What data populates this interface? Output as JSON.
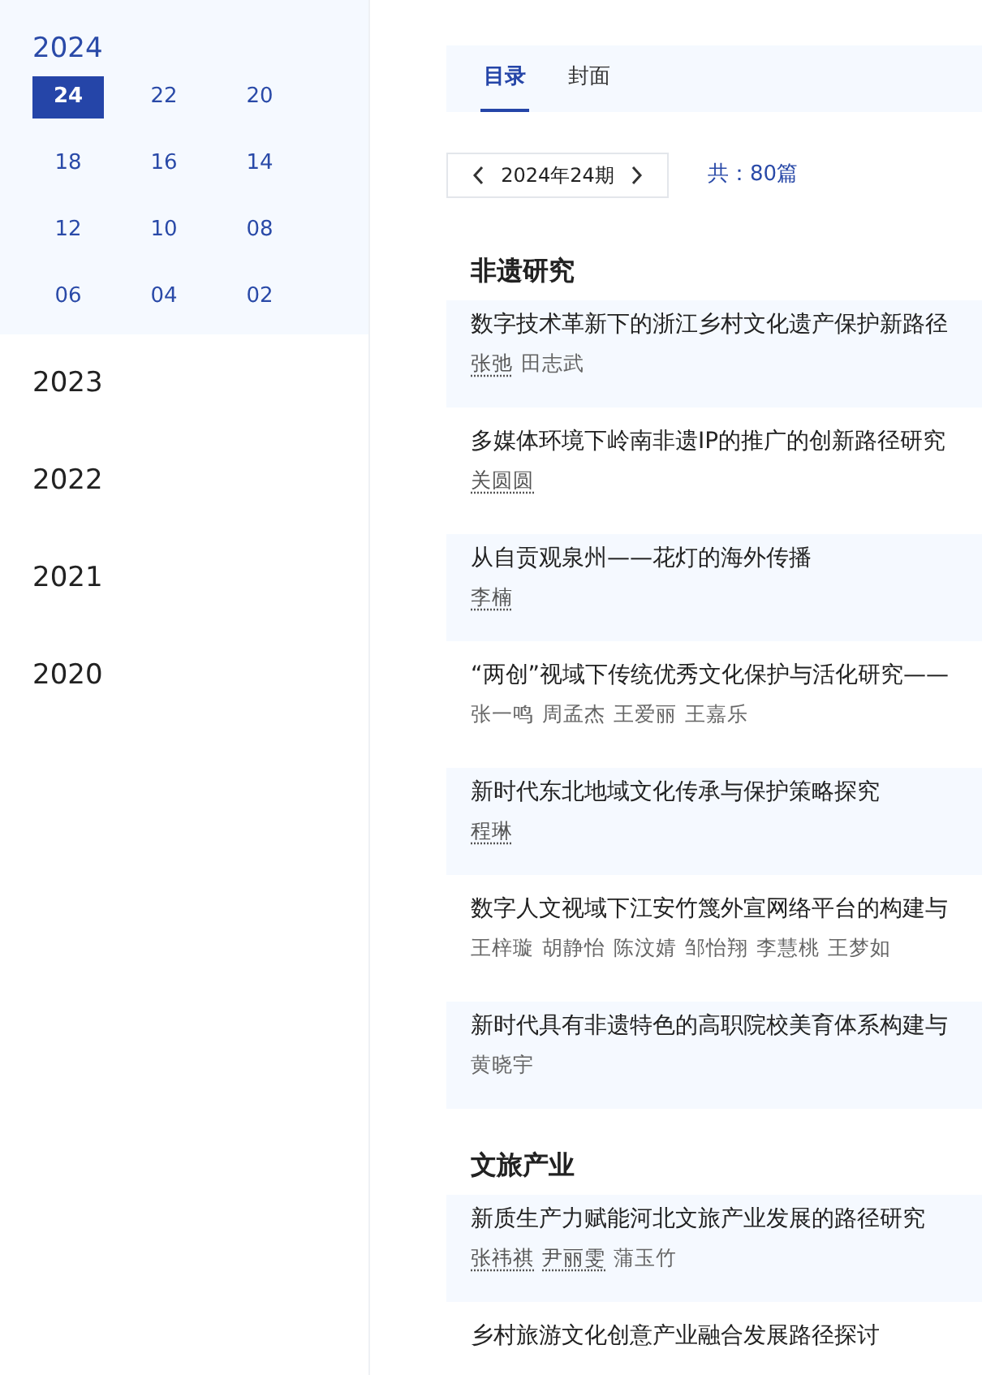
{
  "sidebar": {
    "years": [
      {
        "label": "2024",
        "expanded": true,
        "issues": [
          {
            "label": "24",
            "selected": true
          },
          {
            "label": "22",
            "selected": false
          },
          {
            "label": "20",
            "selected": false
          },
          {
            "label": "18",
            "selected": false
          },
          {
            "label": "16",
            "selected": false
          },
          {
            "label": "14",
            "selected": false
          },
          {
            "label": "12",
            "selected": false
          },
          {
            "label": "10",
            "selected": false
          },
          {
            "label": "08",
            "selected": false
          },
          {
            "label": "06",
            "selected": false
          },
          {
            "label": "04",
            "selected": false
          },
          {
            "label": "02",
            "selected": false
          }
        ]
      },
      {
        "label": "2023",
        "expanded": false
      },
      {
        "label": "2022",
        "expanded": false
      },
      {
        "label": "2021",
        "expanded": false
      },
      {
        "label": "2020",
        "expanded": false
      }
    ]
  },
  "tabs": [
    {
      "label": "目录",
      "selected": true
    },
    {
      "label": "封面",
      "selected": false
    }
  ],
  "issue_nav": {
    "label": "2024年24期",
    "count": "共：80篇"
  },
  "sections": [
    {
      "title": "非遗研究",
      "articles": [
        {
          "title": "数字技术革新下的浙江乡村文化遗产保护新路径",
          "authors": [
            {
              "name": "张弛",
              "linked": true
            },
            {
              "name": "田志武",
              "linked": false
            }
          ]
        },
        {
          "title": "多媒体环境下岭南非遗IP的推广的创新路径研究",
          "authors": [
            {
              "name": "关圆圆",
              "linked": true
            }
          ]
        },
        {
          "title": "从自贡观泉州——花灯的海外传播",
          "authors": [
            {
              "name": "李楠",
              "linked": true
            }
          ]
        },
        {
          "title": "“两创”视域下传统优秀文化保护与活化研究——",
          "authors": [
            {
              "name": "张一鸣",
              "linked": false
            },
            {
              "name": "周孟杰",
              "linked": false
            },
            {
              "name": "王爱丽",
              "linked": false
            },
            {
              "name": "王嘉乐",
              "linked": false
            }
          ]
        },
        {
          "title": "新时代东北地域文化传承与保护策略探究",
          "authors": [
            {
              "name": "程琳",
              "linked": true
            }
          ]
        },
        {
          "title": "数字人文视域下江安竹篾外宣网络平台的构建与",
          "authors": [
            {
              "name": "王梓璇",
              "linked": false
            },
            {
              "name": "胡静怡",
              "linked": false
            },
            {
              "name": "陈汶婧",
              "linked": false
            },
            {
              "name": "邹怡翔",
              "linked": false
            },
            {
              "name": "李慧桃",
              "linked": false
            },
            {
              "name": "王梦如",
              "linked": false
            }
          ]
        },
        {
          "title": "新时代具有非遗特色的高职院校美育体系构建与",
          "authors": [
            {
              "name": "黄晓宇",
              "linked": false
            }
          ]
        }
      ]
    },
    {
      "title": "文旅产业",
      "articles": [
        {
          "title": "新质生产力赋能河北文旅产业发展的路径研究",
          "authors": [
            {
              "name": "张祎祺",
              "linked": true
            },
            {
              "name": "尹丽雯",
              "linked": true
            },
            {
              "name": "蒲玉竹",
              "linked": false
            }
          ]
        },
        {
          "title": "乡村旅游文化创意产业融合发展路径探讨"
        }
      ]
    }
  ]
}
